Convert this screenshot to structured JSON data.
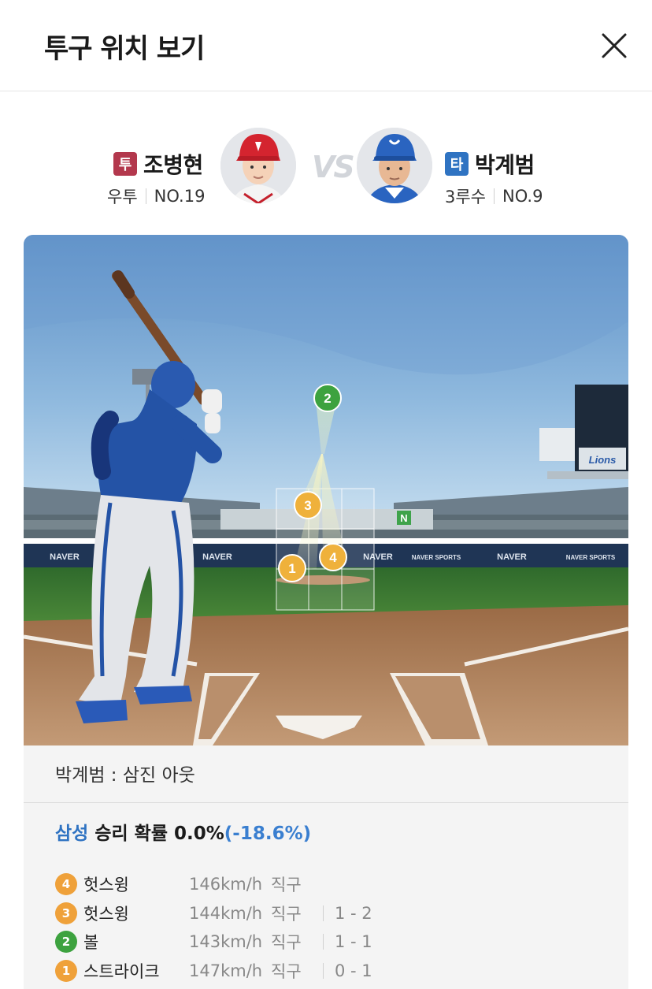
{
  "header": {
    "title": "투구 위치 보기"
  },
  "pitcher": {
    "role": "투",
    "name": "조병현",
    "hand": "우투",
    "number": "NO.19"
  },
  "vs_label": "VS",
  "batter": {
    "role": "타",
    "name": "박계범",
    "position": "3루수",
    "number": "NO.9"
  },
  "field": {
    "sponsor_banner": "NAVER",
    "sponsor_sports": "NAVER SPORTS",
    "scoreboard_team": "Lions",
    "markers": [
      {
        "num": "1",
        "color": "#efb13b"
      },
      {
        "num": "2",
        "color": "#3da23f"
      },
      {
        "num": "3",
        "color": "#efb13b"
      },
      {
        "num": "4",
        "color": "#efb13b"
      }
    ]
  },
  "result": {
    "summary": "박계범 : 삼진 아웃",
    "team": "삼성",
    "win_label": "승리 확률 0.0%",
    "win_delta": "(-18.6%)"
  },
  "pitches": [
    {
      "num": "4",
      "color": "#efa13a",
      "type": "헛스윙",
      "speed": "146km/h",
      "kind": "직구",
      "count": ""
    },
    {
      "num": "3",
      "color": "#efa13a",
      "type": "헛스윙",
      "speed": "144km/h",
      "kind": "직구",
      "count": "1 - 2"
    },
    {
      "num": "2",
      "color": "#3da23f",
      "type": "볼",
      "speed": "143km/h",
      "kind": "직구",
      "count": "1 - 1"
    },
    {
      "num": "1",
      "color": "#efa13a",
      "type": "스트라이크",
      "speed": "147km/h",
      "kind": "직구",
      "count": "0 - 1"
    }
  ]
}
